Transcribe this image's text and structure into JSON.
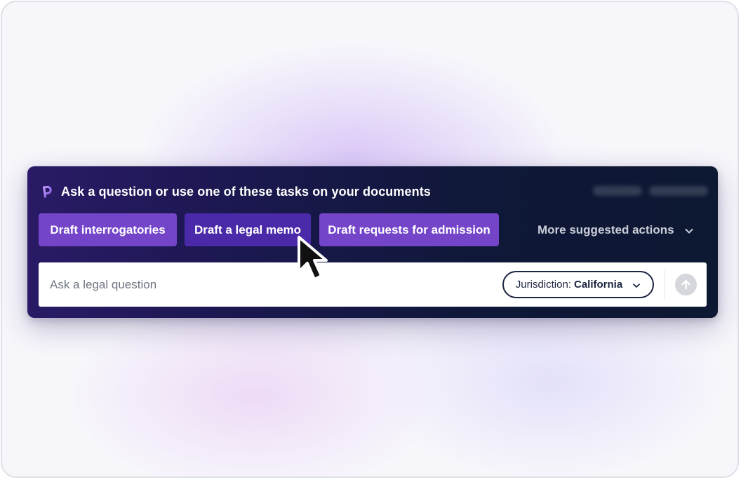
{
  "header": {
    "title": "Ask a question or use one of these tasks on your documents",
    "logo_icon": "brand-p-logo-icon"
  },
  "tasks": [
    {
      "label": "Draft interrogatories"
    },
    {
      "label": "Draft a legal memo"
    },
    {
      "label": "Draft requests for admission"
    }
  ],
  "more_actions": {
    "label": "More suggested actions",
    "icon": "chevron-down-icon"
  },
  "ask_input": {
    "placeholder": "Ask a legal question",
    "value": ""
  },
  "jurisdiction": {
    "label": "Jurisdiction",
    "separator": ":",
    "value": "California",
    "icon": "chevron-down-icon"
  },
  "submit": {
    "icon": "arrow-up-icon"
  },
  "colors": {
    "panel_dark": "#0f1838",
    "panel_purple": "#2a1a66",
    "task_button": "#7445c9",
    "task_button_hover": "#4a2aa8",
    "submit_disabled": "#d5d7dc"
  }
}
